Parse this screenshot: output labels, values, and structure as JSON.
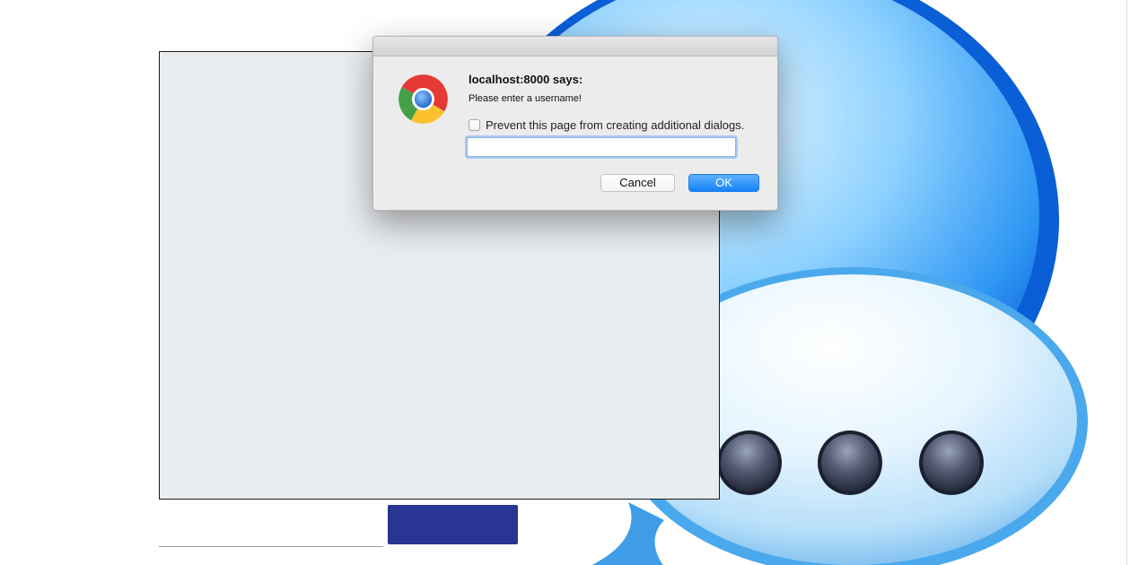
{
  "chat": {
    "message_input_value": "",
    "send_button_label": ""
  },
  "dialog": {
    "title": "localhost:8000 says:",
    "message": "Please enter a username!",
    "prevent_label": "Prevent this page from creating additional dialogs.",
    "prevent_checked": false,
    "input_value": "",
    "cancel_label": "Cancel",
    "ok_label": "OK",
    "icon": "chrome-icon"
  },
  "background": {
    "illustration": "chat-bubbles-icon"
  },
  "colors": {
    "send_button": "#283593",
    "ok_button": "#1483f5",
    "chat_panel": "#eaedf0"
  }
}
